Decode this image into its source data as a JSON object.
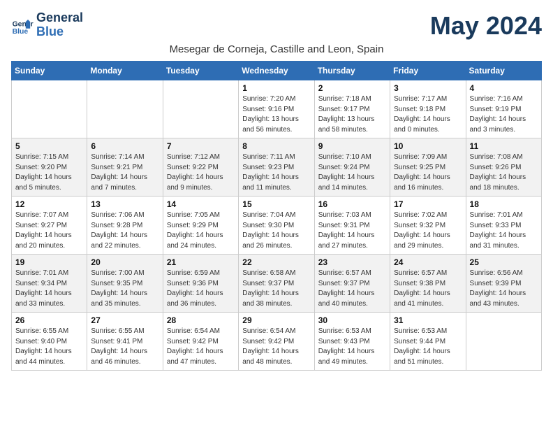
{
  "header": {
    "logo_line1": "General",
    "logo_line2": "Blue",
    "month_title": "May 2024",
    "subtitle": "Mesegar de Corneja, Castille and Leon, Spain"
  },
  "days_of_week": [
    "Sunday",
    "Monday",
    "Tuesday",
    "Wednesday",
    "Thursday",
    "Friday",
    "Saturday"
  ],
  "weeks": [
    [
      {
        "day": "",
        "info": ""
      },
      {
        "day": "",
        "info": ""
      },
      {
        "day": "",
        "info": ""
      },
      {
        "day": "1",
        "info": "Sunrise: 7:20 AM\nSunset: 9:16 PM\nDaylight: 13 hours and 56 minutes."
      },
      {
        "day": "2",
        "info": "Sunrise: 7:18 AM\nSunset: 9:17 PM\nDaylight: 13 hours and 58 minutes."
      },
      {
        "day": "3",
        "info": "Sunrise: 7:17 AM\nSunset: 9:18 PM\nDaylight: 14 hours and 0 minutes."
      },
      {
        "day": "4",
        "info": "Sunrise: 7:16 AM\nSunset: 9:19 PM\nDaylight: 14 hours and 3 minutes."
      }
    ],
    [
      {
        "day": "5",
        "info": "Sunrise: 7:15 AM\nSunset: 9:20 PM\nDaylight: 14 hours and 5 minutes."
      },
      {
        "day": "6",
        "info": "Sunrise: 7:14 AM\nSunset: 9:21 PM\nDaylight: 14 hours and 7 minutes."
      },
      {
        "day": "7",
        "info": "Sunrise: 7:12 AM\nSunset: 9:22 PM\nDaylight: 14 hours and 9 minutes."
      },
      {
        "day": "8",
        "info": "Sunrise: 7:11 AM\nSunset: 9:23 PM\nDaylight: 14 hours and 11 minutes."
      },
      {
        "day": "9",
        "info": "Sunrise: 7:10 AM\nSunset: 9:24 PM\nDaylight: 14 hours and 14 minutes."
      },
      {
        "day": "10",
        "info": "Sunrise: 7:09 AM\nSunset: 9:25 PM\nDaylight: 14 hours and 16 minutes."
      },
      {
        "day": "11",
        "info": "Sunrise: 7:08 AM\nSunset: 9:26 PM\nDaylight: 14 hours and 18 minutes."
      }
    ],
    [
      {
        "day": "12",
        "info": "Sunrise: 7:07 AM\nSunset: 9:27 PM\nDaylight: 14 hours and 20 minutes."
      },
      {
        "day": "13",
        "info": "Sunrise: 7:06 AM\nSunset: 9:28 PM\nDaylight: 14 hours and 22 minutes."
      },
      {
        "day": "14",
        "info": "Sunrise: 7:05 AM\nSunset: 9:29 PM\nDaylight: 14 hours and 24 minutes."
      },
      {
        "day": "15",
        "info": "Sunrise: 7:04 AM\nSunset: 9:30 PM\nDaylight: 14 hours and 26 minutes."
      },
      {
        "day": "16",
        "info": "Sunrise: 7:03 AM\nSunset: 9:31 PM\nDaylight: 14 hours and 27 minutes."
      },
      {
        "day": "17",
        "info": "Sunrise: 7:02 AM\nSunset: 9:32 PM\nDaylight: 14 hours and 29 minutes."
      },
      {
        "day": "18",
        "info": "Sunrise: 7:01 AM\nSunset: 9:33 PM\nDaylight: 14 hours and 31 minutes."
      }
    ],
    [
      {
        "day": "19",
        "info": "Sunrise: 7:01 AM\nSunset: 9:34 PM\nDaylight: 14 hours and 33 minutes."
      },
      {
        "day": "20",
        "info": "Sunrise: 7:00 AM\nSunset: 9:35 PM\nDaylight: 14 hours and 35 minutes."
      },
      {
        "day": "21",
        "info": "Sunrise: 6:59 AM\nSunset: 9:36 PM\nDaylight: 14 hours and 36 minutes."
      },
      {
        "day": "22",
        "info": "Sunrise: 6:58 AM\nSunset: 9:37 PM\nDaylight: 14 hours and 38 minutes."
      },
      {
        "day": "23",
        "info": "Sunrise: 6:57 AM\nSunset: 9:37 PM\nDaylight: 14 hours and 40 minutes."
      },
      {
        "day": "24",
        "info": "Sunrise: 6:57 AM\nSunset: 9:38 PM\nDaylight: 14 hours and 41 minutes."
      },
      {
        "day": "25",
        "info": "Sunrise: 6:56 AM\nSunset: 9:39 PM\nDaylight: 14 hours and 43 minutes."
      }
    ],
    [
      {
        "day": "26",
        "info": "Sunrise: 6:55 AM\nSunset: 9:40 PM\nDaylight: 14 hours and 44 minutes."
      },
      {
        "day": "27",
        "info": "Sunrise: 6:55 AM\nSunset: 9:41 PM\nDaylight: 14 hours and 46 minutes."
      },
      {
        "day": "28",
        "info": "Sunrise: 6:54 AM\nSunset: 9:42 PM\nDaylight: 14 hours and 47 minutes."
      },
      {
        "day": "29",
        "info": "Sunrise: 6:54 AM\nSunset: 9:42 PM\nDaylight: 14 hours and 48 minutes."
      },
      {
        "day": "30",
        "info": "Sunrise: 6:53 AM\nSunset: 9:43 PM\nDaylight: 14 hours and 49 minutes."
      },
      {
        "day": "31",
        "info": "Sunrise: 6:53 AM\nSunset: 9:44 PM\nDaylight: 14 hours and 51 minutes."
      },
      {
        "day": "",
        "info": ""
      }
    ]
  ]
}
